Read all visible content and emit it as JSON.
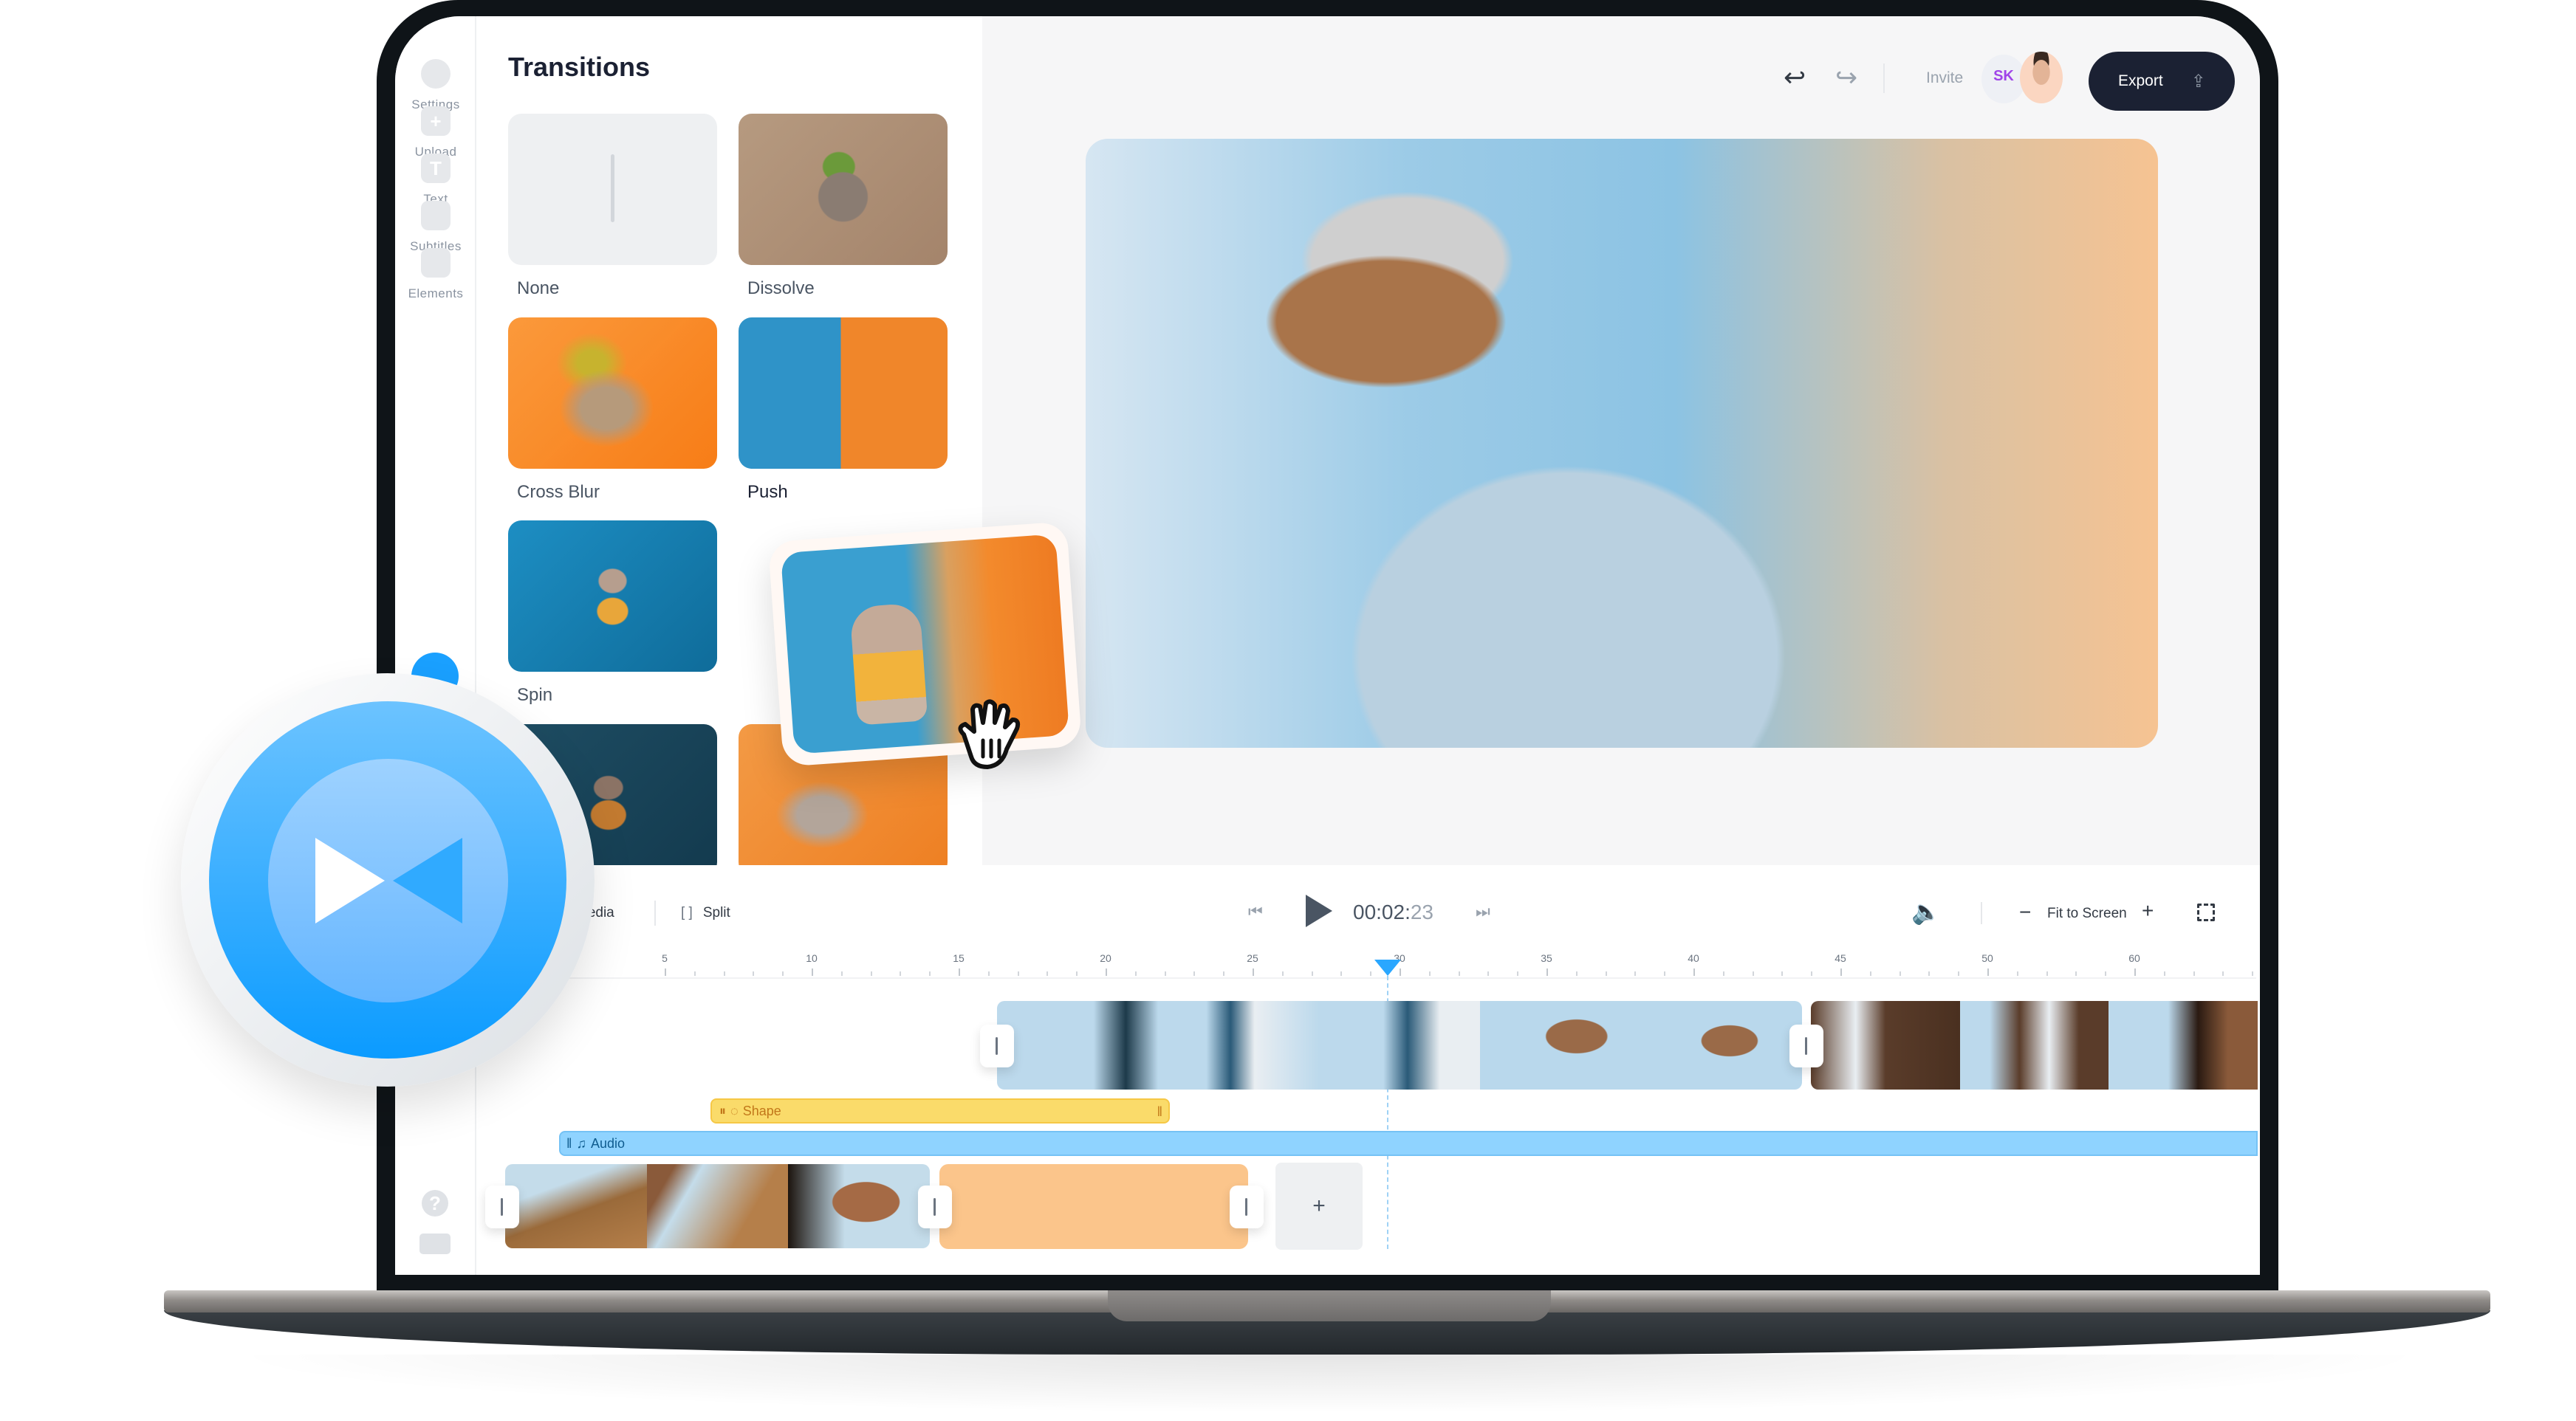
{
  "sidebar": {
    "items": [
      {
        "label": "Settings",
        "icon": "settings-icon"
      },
      {
        "label": "Upload",
        "icon": "upload-icon",
        "glyph": "+"
      },
      {
        "label": "Text",
        "icon": "text-icon",
        "glyph": "T"
      },
      {
        "label": "Subtitles",
        "icon": "subtitles-icon"
      },
      {
        "label": "Elements",
        "icon": "elements-icon"
      }
    ],
    "active_icon": "transitions-icon",
    "help_glyph": "?"
  },
  "panel": {
    "title": "Transitions",
    "tiles": [
      {
        "label": "None"
      },
      {
        "label": "Dissolve"
      },
      {
        "label": "Cross Blur"
      },
      {
        "label": "Push"
      },
      {
        "label": "Spin"
      },
      {
        "label": ""
      },
      {
        "label": ""
      }
    ]
  },
  "header": {
    "undo_glyph": "↩",
    "redo_glyph": "↪",
    "invite_label": "Invite",
    "avatar_initials": "SK",
    "export_label": "Export",
    "export_glyph": "⇪"
  },
  "timeline": {
    "media_label": "Media",
    "split_label": "Split",
    "split_glyph": "[ ]",
    "prev_glyph": "⏮",
    "next_glyph": "⏭",
    "time_main": "00:02:",
    "time_frames": "23",
    "volume_glyph": "🔈",
    "zoom_minus": "−",
    "zoom_label": "Fit to Screen",
    "zoom_plus": "+",
    "ruler_labels": [
      "5",
      "10",
      "15",
      "20",
      "25",
      "30",
      "35",
      "40",
      "45",
      "50",
      "60"
    ],
    "shape_track_label": "Shape",
    "audio_track_label": "Audio",
    "add_clip_glyph": "+",
    "accent_color": "#2aa7ff"
  }
}
